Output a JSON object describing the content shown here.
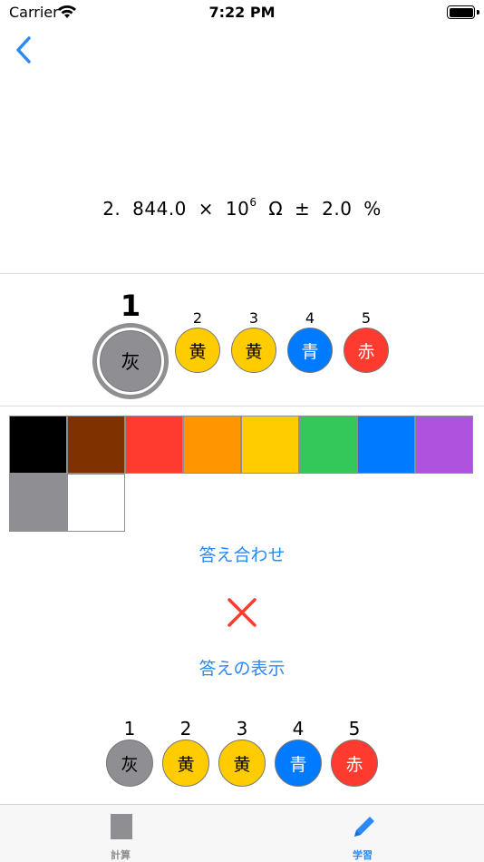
{
  "status_bar": {
    "carrier": "Carrier",
    "time": "7:22 PM"
  },
  "colors": {
    "accent": "#2a8af6",
    "wrong": "#ff3b30",
    "palette": [
      "#000000",
      "#7f3100",
      "#ff3b30",
      "#ff9500",
      "#ffcc00",
      "#34c759",
      "#007aff",
      "#af52de",
      "#8e8e93",
      "#ffffff"
    ]
  },
  "question": {
    "index": "2.",
    "mantissa": "844.0",
    "times": "×",
    "base": "10",
    "exponent": "6",
    "unit": "Ω",
    "pm": "±",
    "tolerance": "2.0",
    "percent": "%"
  },
  "user_bands": [
    {
      "num": "1",
      "label": "灰",
      "color": "#8e8e93",
      "text_color": "#000000"
    },
    {
      "num": "2",
      "label": "黄",
      "color": "#ffcc00",
      "text_color": "#000000"
    },
    {
      "num": "3",
      "label": "黄",
      "color": "#ffcc00",
      "text_color": "#000000"
    },
    {
      "num": "4",
      "label": "青",
      "color": "#007aff",
      "text_color": "#ffffff"
    },
    {
      "num": "5",
      "label": "赤",
      "color": "#ff3b30",
      "text_color": "#ffffff"
    }
  ],
  "buttons": {
    "check": "答え合わせ",
    "show_answer": "答えの表示"
  },
  "answer_bands": [
    {
      "num": "1",
      "label": "灰",
      "color": "#8e8e93",
      "text_color": "#000000"
    },
    {
      "num": "2",
      "label": "黄",
      "color": "#ffcc00",
      "text_color": "#000000"
    },
    {
      "num": "3",
      "label": "黄",
      "color": "#ffcc00",
      "text_color": "#000000"
    },
    {
      "num": "4",
      "label": "青",
      "color": "#007aff",
      "text_color": "#ffffff"
    },
    {
      "num": "5",
      "label": "赤",
      "color": "#ff3b30",
      "text_color": "#ffffff"
    }
  ],
  "tabs": [
    {
      "label": "計算",
      "color": "#8e8e93"
    },
    {
      "label": "学習",
      "color": "#2a8af6"
    }
  ]
}
